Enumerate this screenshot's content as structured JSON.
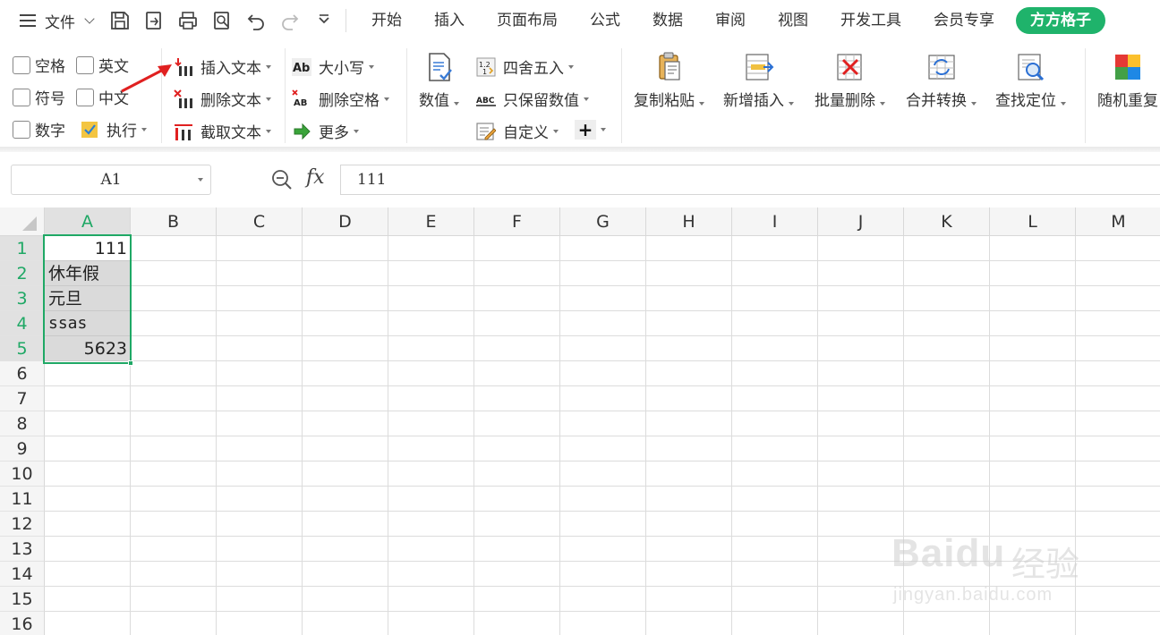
{
  "menubar": {
    "file_label": "文件",
    "tabs": [
      "开始",
      "插入",
      "页面布局",
      "公式",
      "数据",
      "审阅",
      "视图",
      "开发工具",
      "会员专享"
    ],
    "brand_tab": "方方格子",
    "quick_access": [
      "save-icon",
      "export-icon",
      "print-icon",
      "print-preview-icon",
      "undo-icon",
      "redo-icon",
      "customize-icon"
    ]
  },
  "ribbon": {
    "checkboxes": [
      "空格",
      "英文",
      "符号",
      "中文",
      "数字"
    ],
    "execute": "执行",
    "text_tools": [
      "插入文本",
      "删除文本",
      "截取文本"
    ],
    "case_tools": [
      "大小写",
      "删除空格",
      "更多"
    ],
    "number_label": "数值",
    "number_tools": [
      "四舍五入",
      "只保留数值",
      "自定义"
    ],
    "plus_label": "+",
    "big_buttons": [
      "复制粘贴",
      "新增插入",
      "批量删除",
      "合并转换",
      "查找定位",
      "随机重复"
    ]
  },
  "formula_bar": {
    "name_box": "A1",
    "fx_label": "fx",
    "formula": "111"
  },
  "sheet": {
    "columns": [
      "A",
      "B",
      "C",
      "D",
      "E",
      "F",
      "G",
      "H",
      "I",
      "J",
      "K",
      "L",
      "M"
    ],
    "rows": [
      "1",
      "2",
      "3",
      "4",
      "5",
      "6",
      "7",
      "8",
      "9",
      "10",
      "11",
      "12",
      "13",
      "14",
      "15",
      "16"
    ],
    "selected_column": "A",
    "cells": {
      "A1": "111",
      "A2": "休年假",
      "A3": "元旦",
      "A4": "ssas",
      "A5": "5623"
    }
  },
  "watermark": {
    "logo": "Bai",
    "logo_tail": "du",
    "cn": "经验",
    "url": "jingyan.baidu.com"
  },
  "colors": {
    "accent": "#1fa865",
    "brand": "#1fb36b",
    "arrow": "#e02020"
  }
}
